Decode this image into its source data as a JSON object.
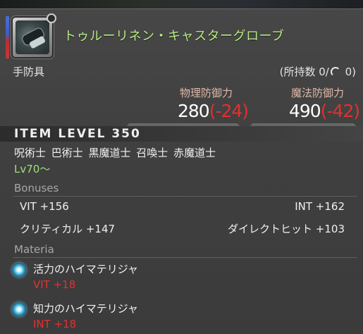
{
  "item": {
    "name": "トゥルーリネン・キャスターグローブ",
    "category": "手防具",
    "owned": {
      "prefix": "(所持数 0/",
      "suffix": " 0)"
    },
    "item_level": "ITEM LEVEL 350",
    "jobs": "呪術士 巴術士 黒魔道士 召喚士 赤魔道士",
    "level_requirement": "Lv70～"
  },
  "stats": {
    "physical": {
      "label": "物理防御力",
      "value": "280",
      "diff": "(-24)"
    },
    "magical": {
      "label": "魔法防御力",
      "value": "490",
      "diff": "(-42)"
    }
  },
  "bonuses": {
    "title": "Bonuses",
    "items": [
      {
        "text": "VIT +156"
      },
      {
        "text": "INT +162"
      },
      {
        "text": "クリティカル +147"
      },
      {
        "text": "ダイレクトヒット +103"
      }
    ]
  },
  "materia": {
    "title": "Materia",
    "items": [
      {
        "name": "活力のハイマテリジャ",
        "stat": "VIT +18"
      },
      {
        "name": "知力のハイマテリジャ",
        "stat": "INT +18"
      }
    ]
  },
  "colors": {
    "item_name": "#b8ec84",
    "stat_label": "#e0b8a8",
    "negative": "#e23030",
    "level_req": "#9ee07a",
    "section_title": "#a7a7a7"
  },
  "icons": [
    "glove-item-icon",
    "hq-icon",
    "materia-orb-icon"
  ]
}
